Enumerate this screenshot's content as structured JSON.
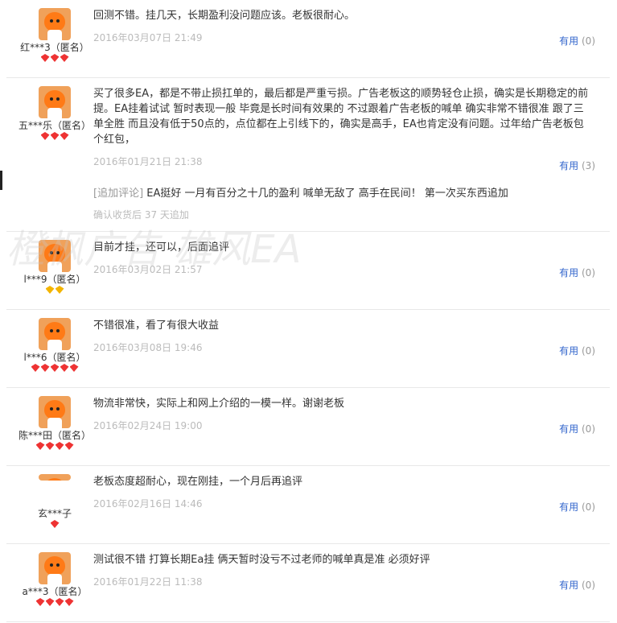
{
  "watermark": "橙枫广告 雄风EA",
  "reviews": [
    {
      "username": "红***3（匿名）",
      "text": "回测不错。挂几天，长期盈利没问题应该。老板很耐心。",
      "date": "2016年03月07日 21:49",
      "useful_label": "有用",
      "useful_count": "(0)",
      "rank_gems": 3,
      "rank_color": "red"
    },
    {
      "username": "五***乐（匿名）",
      "text": "买了很多EA，都是不带止损扛单的，最后都是严重亏损。广告老板这的顺势轻仓止损，确实是长期稳定的前提。EA挂着试试 暂时表现一般 毕竟是长时间有效果的 不过跟着广告老板的喊单 确实非常不错很准 跟了三单全胜 而且没有低于50点的，点位都在上引线下的，确实是高手，EA也肯定没有问题。过年给广告老板包个红包，",
      "date": "2016年01月21日 21:38",
      "useful_label": "有用",
      "useful_count": "(3)",
      "rank_gems": 3,
      "rank_color": "red",
      "append_tag": "[追加评论]",
      "append_text": " EA挺好 一月有百分之十几的盈利 喊单无敌了 高手在民间！ 第一次买东西追加",
      "append_meta": "确认收货后 37 天追加"
    },
    {
      "username": "l***9（匿名）",
      "text": "目前才挂，还可以，后面追评",
      "date": "2016年03月02日 21:57",
      "useful_label": "有用",
      "useful_count": "(0)",
      "rank_gems": 2,
      "rank_color": "gold"
    },
    {
      "username": "l***6（匿名）",
      "text": "不错很准，看了有很大收益",
      "date": "2016年03月08日 19:46",
      "useful_label": "有用",
      "useful_count": "(0)",
      "rank_gems": 5,
      "rank_color": "red"
    },
    {
      "username": "陈***田（匿名）",
      "text": "物流非常快，实际上和网上介绍的一模一样。谢谢老板",
      "date": "2016年02月24日 19:00",
      "useful_label": "有用",
      "useful_count": "(0)",
      "rank_gems": 4,
      "rank_color": "red"
    },
    {
      "username": "玄***子",
      "text": "老板态度超耐心，现在刚挂，一个月后再追评",
      "date": "2016年02月16日 14:46",
      "useful_label": "有用",
      "useful_count": "(0)",
      "rank_gems": 1,
      "rank_color": "red"
    },
    {
      "username": "a***3（匿名）",
      "text": "测试很不错 打算长期Ea挂 俩天暂时没亏不过老师的喊单真是准 必须好评",
      "date": "2016年01月22日 11:38",
      "useful_label": "有用",
      "useful_count": "(0)",
      "rank_gems": 4,
      "rank_color": "red"
    }
  ]
}
